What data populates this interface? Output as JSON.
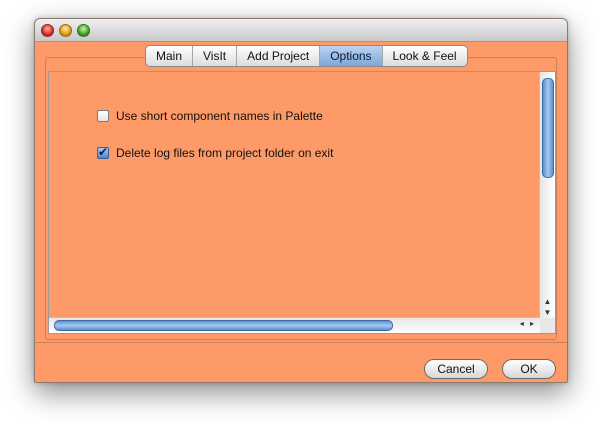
{
  "window": {
    "controls": [
      "close-icon",
      "minimize-icon",
      "zoom-icon"
    ]
  },
  "tabs": [
    {
      "label": "Main",
      "active": false
    },
    {
      "label": "VisIt",
      "active": false
    },
    {
      "label": "Add Project",
      "active": false
    },
    {
      "label": "Options",
      "active": true
    },
    {
      "label": "Look & Feel",
      "active": false
    }
  ],
  "options": {
    "short_names": {
      "label": "Use short component names in Palette",
      "checked": false
    },
    "delete_logs": {
      "label": "Delete log files from project folder on exit",
      "checked": true
    }
  },
  "scrollbars": {
    "vertical_arrows": "▲▼",
    "horizontal_arrows": "◂ ▸"
  },
  "buttons": {
    "cancel_label": "Cancel",
    "ok_label": "OK"
  },
  "colors": {
    "background": "#fe9a68",
    "accent": "#7fa6d8"
  }
}
